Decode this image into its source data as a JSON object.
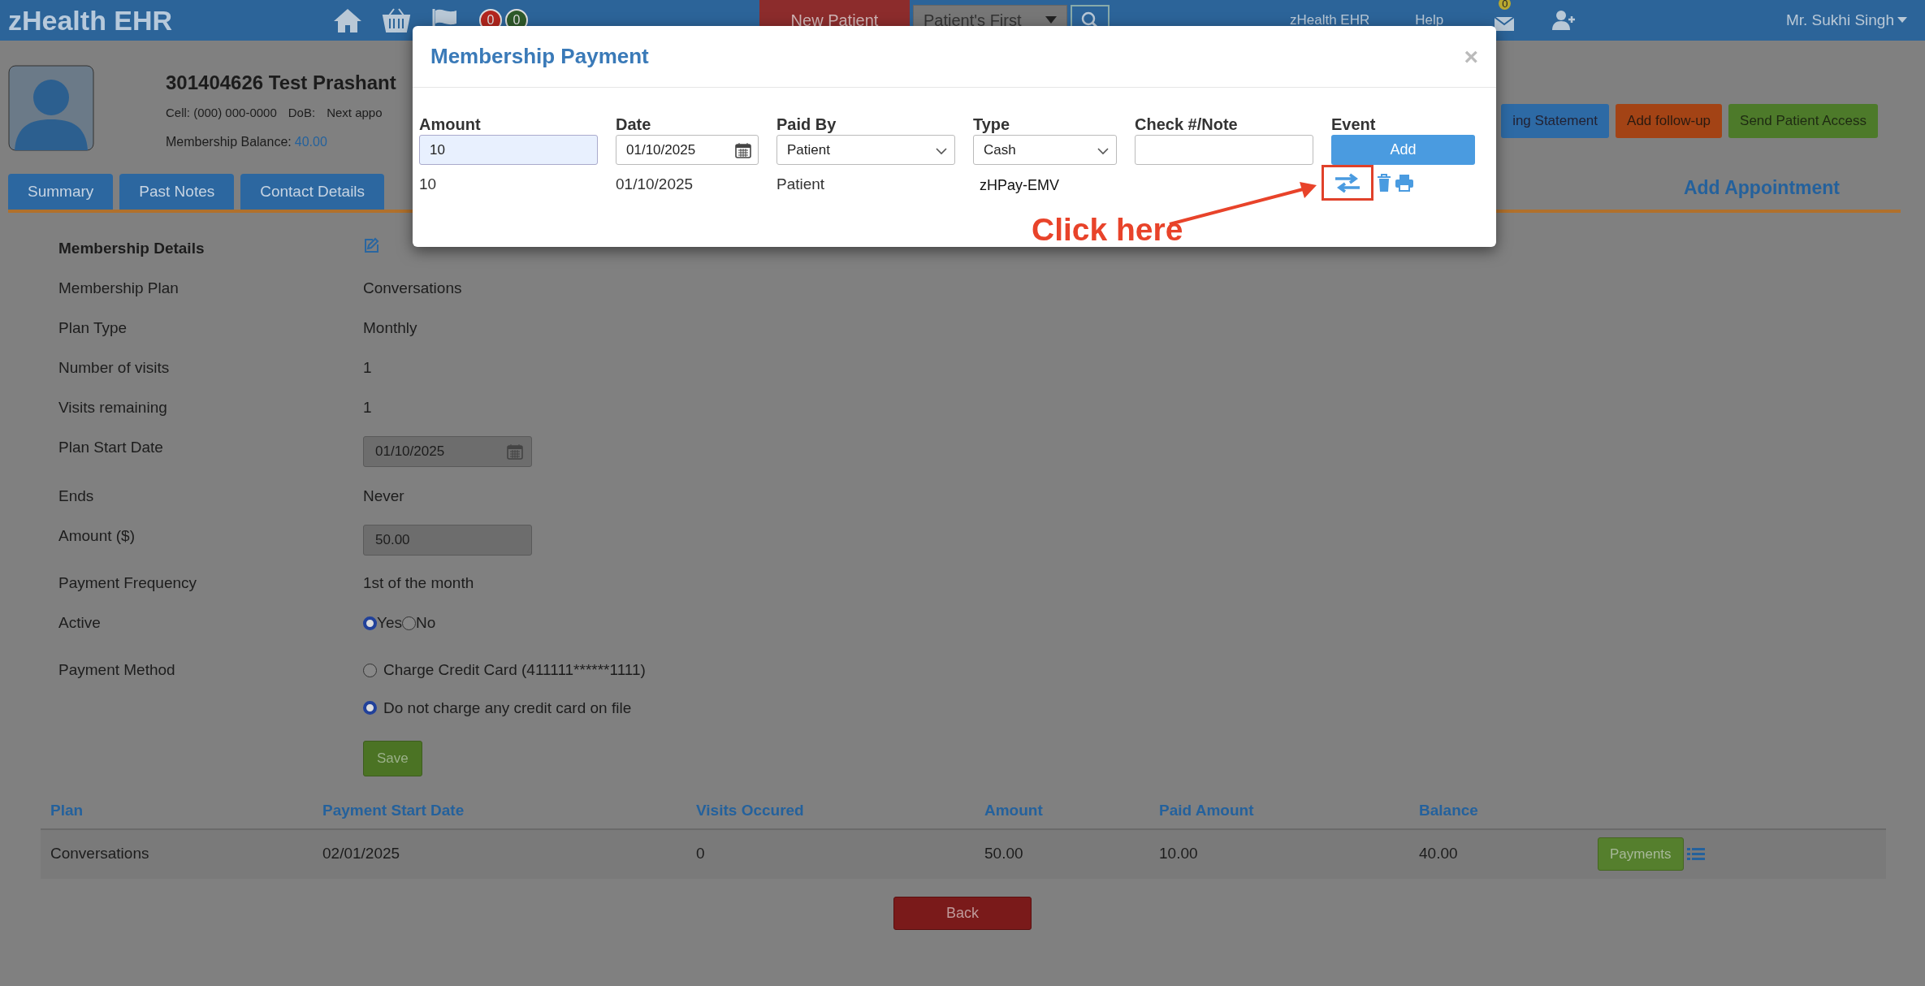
{
  "navbar": {
    "brand": "zHealth EHR",
    "counters": [
      {
        "count": "0",
        "color": "#b3261e"
      },
      {
        "count": "0",
        "color": "#2f5a2a"
      }
    ],
    "new_patient": "New Patient",
    "patient_search": "Patient's First",
    "links": [
      "zHealth EHR",
      "Help"
    ],
    "mail_count": "0",
    "user": "Mr. Sukhi Singh"
  },
  "patient": {
    "name": "301404626 Test Prashant",
    "cell": "Cell: (000) 000-0000",
    "dob": "DoB:",
    "next_appointment": "Next appo",
    "balance_label": "Membership Balance:",
    "balance": "40.00"
  },
  "actions": [
    {
      "label": "ing Statement",
      "kind": "primary"
    },
    {
      "label": "Add follow-up",
      "kind": "warning"
    },
    {
      "label": "Send Patient Access",
      "kind": "success"
    }
  ],
  "tabs": [
    {
      "label": "Summary",
      "selected": false
    },
    {
      "label": "Past Notes",
      "selected": false
    },
    {
      "label": "Contact Details",
      "selected": false
    }
  ],
  "add_appointment": "Add Appointment",
  "details": {
    "title": "Membership Details",
    "rows": [
      {
        "label": "Membership Plan",
        "kind": "text",
        "value": "Conversations"
      },
      {
        "label": "Plan Type",
        "kind": "text",
        "value": "Monthly"
      },
      {
        "label": "Number of visits",
        "kind": "text",
        "value": "1"
      },
      {
        "label": "Visits remaining",
        "kind": "text",
        "value": "1"
      },
      {
        "label": "Plan Start Date",
        "kind": "date",
        "value": "01/10/2025"
      },
      {
        "label": "Ends",
        "kind": "text",
        "value": "Never"
      },
      {
        "label": "Amount ($)",
        "kind": "input",
        "value": "50.00"
      },
      {
        "label": "Payment Frequency",
        "kind": "text",
        "value": "1st of the month"
      },
      {
        "label": "Active",
        "kind": "inline_radios",
        "options": [
          {
            "label": "Yes",
            "selected": true
          },
          {
            "label": "No",
            "selected": false
          }
        ]
      },
      {
        "label": "Payment Method",
        "kind": "stacked_radios",
        "options": [
          {
            "label": "Charge Credit Card (411111******1111)",
            "selected": false
          },
          {
            "label": "Do not charge any credit card on file",
            "selected": true
          }
        ]
      }
    ],
    "save": "Save"
  },
  "table": {
    "columns": [
      "Plan",
      "Payment Start Date",
      "Visits Occured",
      "Amount",
      "Paid Amount",
      "Balance"
    ],
    "rows": [
      {
        "cells": [
          "Conversations",
          "02/01/2025",
          "0",
          "50.00",
          "10.00",
          "40.00"
        ],
        "button": "Payments"
      }
    ]
  },
  "back": "Back",
  "modal": {
    "title": "Membership Payment",
    "close": "×",
    "fields": [
      {
        "label": "Amount",
        "kind": "text",
        "value": "10",
        "focused": true
      },
      {
        "label": "Date",
        "kind": "date",
        "value": "01/10/2025"
      },
      {
        "label": "Paid By",
        "kind": "select",
        "value": "Patient"
      },
      {
        "label": "Type",
        "kind": "select",
        "value": "Cash"
      },
      {
        "label": "Check #/Note",
        "kind": "text",
        "focused": false
      },
      {
        "label": "Event",
        "kind": "button",
        "value": "Add"
      }
    ],
    "rows": [
      {
        "amount": "10",
        "date": "01/10/2025",
        "paid_by": "Patient",
        "type": "zHPay-EMV"
      }
    ]
  },
  "annotation": {
    "text": "Click here"
  }
}
